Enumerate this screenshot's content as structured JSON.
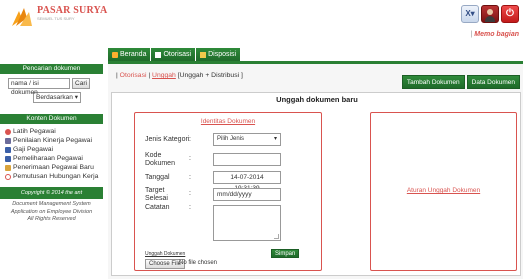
{
  "header": {
    "brand": "PASAR SURYA",
    "brand_sub": "SEMUEL TUS SURY",
    "memo_separator": "|",
    "memo_label": "Memo bagian",
    "icons": [
      "x-dropdown-icon",
      "user-icon",
      "power-icon"
    ],
    "x_glyph": "X▾",
    "power_glyph": "⏻"
  },
  "nav": {
    "tabs": [
      {
        "label": "Beranda",
        "icon": "home-icon"
      },
      {
        "label": "Otorisasi",
        "icon": "authorization-icon"
      },
      {
        "label": "Disposisi",
        "icon": "disposition-icon"
      }
    ]
  },
  "sidebar": {
    "search_heading": "Pencarian dokumen",
    "search_value": "nama / isi dokumen",
    "search_button": "Cari",
    "sort_value": "Berdasarkan",
    "sort_arrow": "▾",
    "content_heading": "Konten Dokumen",
    "items": [
      {
        "label": "Latih Pegawai",
        "color": "#d9534f"
      },
      {
        "label": "Penilaian Kinerja Pegawai",
        "color": "#6b6b9a"
      },
      {
        "label": "Gaji Pegawai",
        "color": "#3b5fa8"
      },
      {
        "label": "Pemeliharaan Pegawai",
        "color": "#3b5fa8"
      },
      {
        "label": "Penerimaan Pegawai Baru",
        "color": "#d9a33b"
      },
      {
        "label": "Pemutusan Hubungan Kerja",
        "color": "#d9534f"
      }
    ],
    "copyright": "Copyright © 2014 the ant",
    "footer_lines": [
      "Document Management System",
      "Application on Employee Division",
      "All Rights Reserved"
    ]
  },
  "main": {
    "crumb_start": "| ",
    "crumb_link1": "Otorisasi",
    "crumb_sep": " | ",
    "crumb_link2": "Unggah",
    "crumb_rest": " [Unggah + Distribusi ]",
    "actions": [
      "Tambah Dokumen",
      "Data Dokumen"
    ],
    "panel_title": "Unggah dokumen baru",
    "identity_title": "Identitas Dokumen",
    "fields": {
      "jenis_label": "Jenis Kategori",
      "jenis_value": "Pilih Jenis",
      "kode_label_1": "Kode",
      "kode_label_2": "Dokumen",
      "kode_value": "",
      "tanggal_label": "Tanggal",
      "tanggal_value": "14-07-2014 19:31:39",
      "target_label_1": "Target",
      "target_label_2": "Selesai",
      "target_placeholder": "mm/dd/yyyy",
      "catatan_label": "Catatan",
      "catatan_value": ""
    },
    "colon": ":",
    "save_button": "Simpan",
    "upload_doc_label": "Unggah Dokumen",
    "file_button": "Choose File",
    "file_status": "No file chosen",
    "upload_rules": "Aturan Unggah Dokumen"
  }
}
